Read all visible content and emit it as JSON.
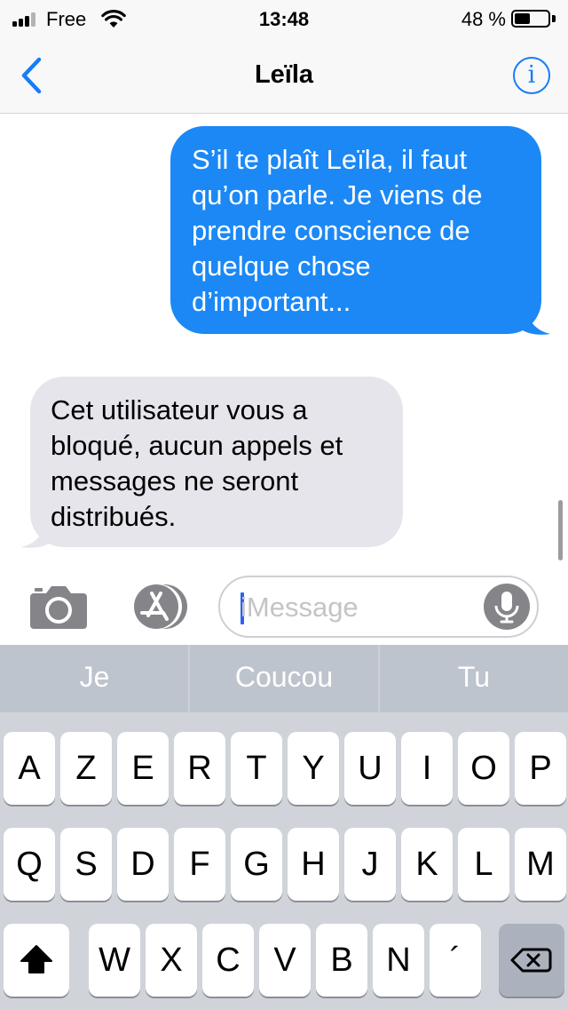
{
  "status_bar": {
    "carrier": "Free",
    "time": "13:48",
    "battery_percent": "48 %",
    "battery_level": 0.48,
    "signal_bars": 3
  },
  "nav": {
    "title": "Leïla",
    "back_icon": "chevron-left-icon",
    "info_icon": "info-icon",
    "info_glyph": "i"
  },
  "messages": [
    {
      "direction": "outgoing",
      "lines": [
        "S’il te plaît Leïla, il faut",
        "qu’on parle. Je viens de",
        "prendre conscience de",
        "quelque chose",
        "d’important..."
      ]
    },
    {
      "direction": "incoming",
      "lines": [
        "Cet utilisateur vous a",
        "bloqué, aucun appels et",
        "messages ne seront",
        "distribués."
      ]
    }
  ],
  "composer": {
    "placeholder": "iMessage",
    "camera_icon": "camera-icon",
    "appstore_icon": "app-store-icon",
    "mic_icon": "microphone-icon"
  },
  "keyboard": {
    "suggestions": [
      "Je",
      "Coucou",
      "Tu"
    ],
    "row1": [
      "A",
      "Z",
      "E",
      "R",
      "T",
      "Y",
      "U",
      "I",
      "O",
      "P"
    ],
    "row2": [
      "Q",
      "S",
      "D",
      "F",
      "G",
      "H",
      "J",
      "K",
      "L",
      "M"
    ],
    "row3": [
      "W",
      "X",
      "C",
      "V",
      "B",
      "N",
      "´"
    ],
    "shift_icon": "shift-icon",
    "backspace_icon": "backspace-icon"
  },
  "colors": {
    "accent": "#1a7cf5",
    "outgoing_bubble": "#1b88f6",
    "incoming_bubble": "#e6e5eb",
    "keyboard_bg": "#d0d3d9"
  }
}
